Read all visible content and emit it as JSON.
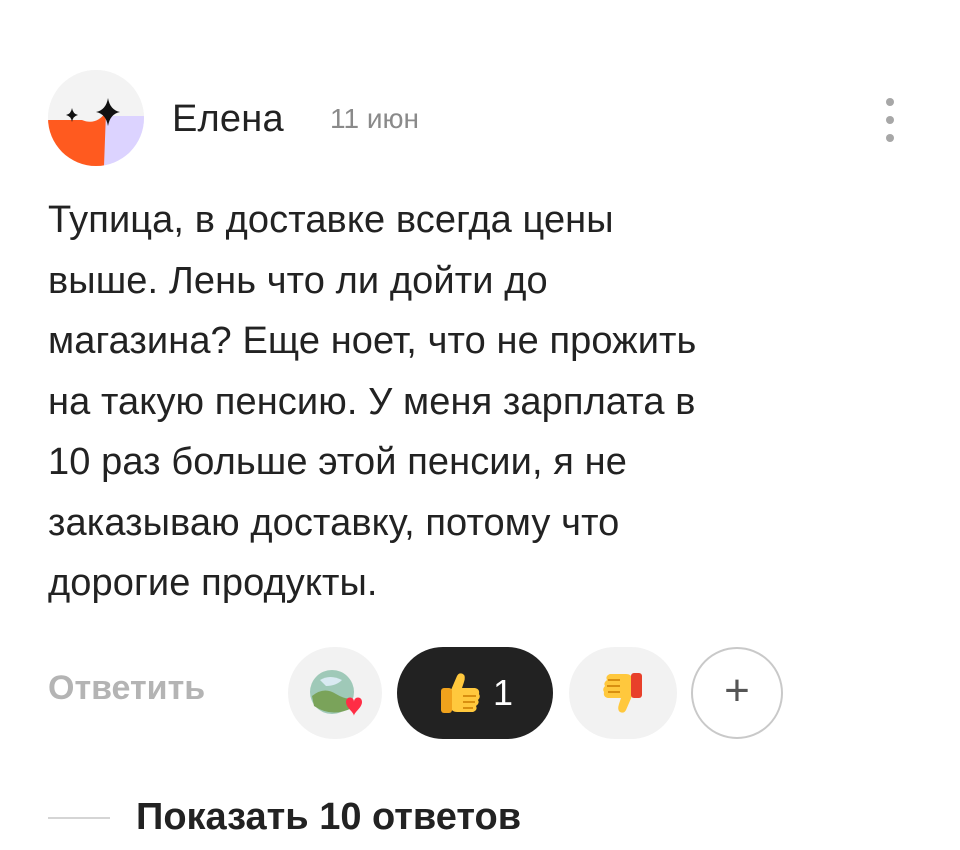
{
  "comment_header": {
    "author": "Елена",
    "date": "11 июн",
    "more_icon": "vertical-ellipsis-icon",
    "avatar_colors": {
      "orange": "#ff5a1f",
      "lavender": "#dcd3ff",
      "background": "#f3f3f3"
    }
  },
  "comment": {
    "lines": [
      "Тупица, в доставке всегда цены",
      "выше. Лень что ли дойти до",
      "магазина? Еще ноет, что не прожить",
      "на такую пенсию. У меня зарплата в",
      "10 раз больше этой пенсии, я не",
      "заказываю доставку, потому что",
      "дорогие продукты."
    ]
  },
  "actions": {
    "reply_label": "Ответить",
    "reactions": [
      {
        "type": "avatar-heart",
        "icon": "avatar-heart-icon"
      },
      {
        "type": "like",
        "icon": "thumbs-up-icon",
        "count": "1",
        "selected": true
      },
      {
        "type": "dislike",
        "icon": "thumbs-down-icon"
      }
    ],
    "add_reaction_label": "+"
  },
  "replies": {
    "label": "Показать 10 ответов"
  },
  "colors": {
    "like_pill": "#222222",
    "pill_bg": "#f2f2f2",
    "muted_text": "#b4b4b4",
    "date_text": "#8a8a8a"
  }
}
